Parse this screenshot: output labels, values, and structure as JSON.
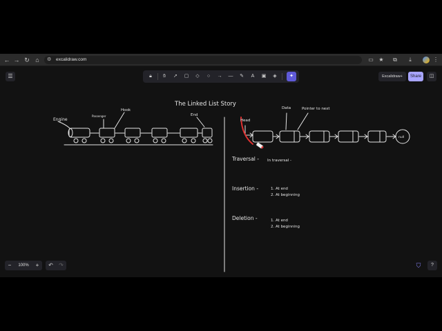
{
  "browser": {
    "url": "excalidraw.com",
    "nav": {
      "back_icon": "arrow-left-icon",
      "forward_icon": "arrow-right-icon",
      "reload_icon": "reload-icon",
      "home_icon": "home-icon"
    }
  },
  "excalidraw": {
    "toolbar": {
      "tools": [
        {
          "name": "lock",
          "icon": "lock-icon"
        },
        {
          "name": "hand",
          "icon": "hand-icon"
        },
        {
          "name": "select",
          "icon": "cursor-icon"
        },
        {
          "name": "rectangle",
          "icon": "rectangle-icon"
        },
        {
          "name": "diamond",
          "icon": "diamond-icon"
        },
        {
          "name": "ellipse",
          "icon": "ellipse-icon"
        },
        {
          "name": "arrow",
          "icon": "arrow-icon"
        },
        {
          "name": "line",
          "icon": "line-icon"
        },
        {
          "name": "draw",
          "icon": "pencil-icon"
        },
        {
          "name": "text",
          "icon": "text-icon"
        },
        {
          "name": "image",
          "icon": "image-icon"
        },
        {
          "name": "eraser",
          "icon": "eraser-icon"
        },
        {
          "name": "laser",
          "icon": "laser-icon",
          "active": true
        }
      ]
    },
    "library_label": "Excalidraw+",
    "share_label": "Share",
    "zoom": "100%",
    "accent_color": "#a8a5ff"
  },
  "drawing": {
    "title": "The Linked List Story",
    "train_labels": {
      "engine": "Engine",
      "passenger": "Passenger",
      "hook": "Hook",
      "end": "End"
    },
    "list_labels": {
      "head": "Head",
      "data": "Data",
      "pointer": "Pointer to next",
      "null": "null"
    },
    "sections": {
      "traversal": "Traversal -",
      "traversal_note": "In traversal -",
      "insertion": "Insertion -",
      "insertion_items": [
        "1. At end",
        "2. At beginning"
      ],
      "deletion": "Deletion -",
      "deletion_items": [
        "1. At end",
        "2. At beginning"
      ]
    }
  }
}
